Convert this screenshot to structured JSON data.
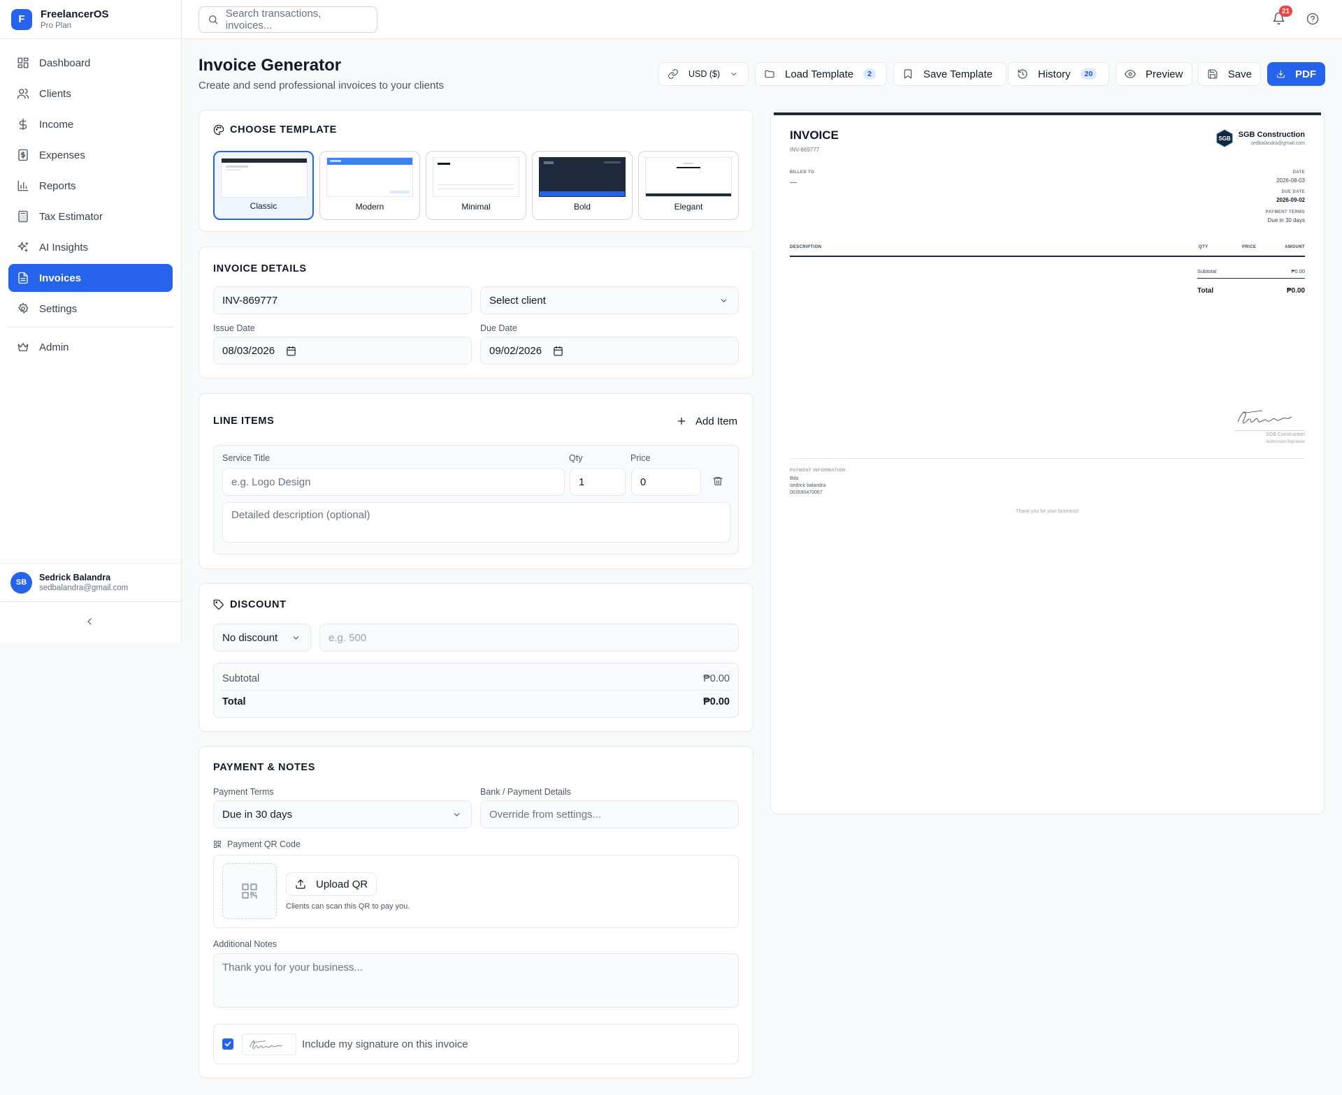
{
  "brand": {
    "logo_letter": "F",
    "name": "FreelancerOS",
    "plan": "Pro Plan"
  },
  "nav": {
    "dashboard": "Dashboard",
    "clients": "Clients",
    "income": "Income",
    "expenses": "Expenses",
    "reports": "Reports",
    "tax": "Tax Estimator",
    "ai": "AI Insights",
    "invoices": "Invoices",
    "settings": "Settings",
    "admin": "Admin",
    "active": "Invoices"
  },
  "user": {
    "initials": "SB",
    "name": "Sedrick Balandra",
    "email": "sedbalandra@gmail.com"
  },
  "topbar": {
    "search_placeholder": "Search transactions, invoices...",
    "notifications": "21"
  },
  "header": {
    "title": "Invoice Generator",
    "subtitle": "Create and send professional invoices to your clients"
  },
  "toolbar": {
    "currency": "USD ($)",
    "load_template": "Load Template",
    "load_count": "2",
    "save_template": "Save Template",
    "history": "History",
    "history_count": "20",
    "preview": "Preview",
    "save": "Save",
    "pdf": "PDF"
  },
  "templates": {
    "title": "CHOOSE TEMPLATE",
    "items": [
      {
        "name": "Classic",
        "selected": true
      },
      {
        "name": "Modern",
        "selected": false
      },
      {
        "name": "Minimal",
        "selected": false
      },
      {
        "name": "Bold",
        "selected": false
      },
      {
        "name": "Elegant",
        "selected": false
      }
    ]
  },
  "details": {
    "title": "INVOICE DETAILS",
    "invoice_number": "INV-869777",
    "client_placeholder": "Select client",
    "issue_label": "Issue Date",
    "issue_value": "08/03/2026",
    "due_label": "Due Date",
    "due_value": "09/02/2026"
  },
  "line_items": {
    "title": "LINE ITEMS",
    "add_label": "Add Item",
    "service_label": "Service Title",
    "service_placeholder": "e.g. Logo Design",
    "qty_label": "Qty",
    "qty_value": "1",
    "price_label": "Price",
    "price_value": "0",
    "description_placeholder": "Detailed description (optional)"
  },
  "discount": {
    "title": "DISCOUNT",
    "type": "No discount",
    "amount_placeholder": "e.g. 500",
    "subtotal_label": "Subtotal",
    "subtotal_value": "₱0.00",
    "total_label": "Total",
    "total_value": "₱0.00"
  },
  "payment": {
    "title": "PAYMENT & NOTES",
    "terms_label": "Payment Terms",
    "terms_value": "Due in 30 days",
    "bank_label": "Bank / Payment Details",
    "bank_placeholder": "Override from settings...",
    "qr_label": "Payment QR Code",
    "upload_label": "Upload QR",
    "qr_hint": "Clients can scan this QR to pay you.",
    "notes_label": "Additional Notes",
    "notes_placeholder": "Thank you for your business...",
    "signature_label": "Include my signature on this invoice",
    "signature_checked": true
  },
  "preview": {
    "heading": "INVOICE",
    "number": "INV-869777",
    "company_logo": "SGB",
    "company_name": "SGB Construction",
    "company_email": "sedbalandra@gmail.com",
    "billed_to_label": "BILLED TO",
    "billed_to_value": "—",
    "date_label": "DATE",
    "date_value": "2026-08-03",
    "due_label": "DUE DATE",
    "due_value": "2026-09-02",
    "terms_label": "PAYMENT TERMS",
    "terms_value": "Due in 30 days",
    "col_description": "DESCRIPTION",
    "col_qty": "QTY",
    "col_price": "PRICE",
    "col_amount": "AMOUNT",
    "subtotal_label": "Subtotal",
    "subtotal_value": "₱0.00",
    "total_label": "Total",
    "total_value": "₱0.00",
    "signer_company": "SGB Construction",
    "signer_caption": "Authorized Signature",
    "payinfo_label": "PAYMENT INFORMATION",
    "bank": "Bdo",
    "account_name": "sedrick balandra",
    "account_number": "003590470067",
    "thanks": "Thank you for your business!"
  },
  "colors": {
    "accent": "#2563eb",
    "danger": "#ef4444",
    "text": "#111827",
    "muted": "#6b7280"
  },
  "icons": [
    "grid-icon",
    "users-icon",
    "dollar-icon",
    "receipt-icon",
    "bar-chart-icon",
    "calculator-icon",
    "sparkles-icon",
    "file-icon",
    "gear-icon",
    "crown-icon",
    "search-icon",
    "bell-icon",
    "help-icon",
    "link-icon",
    "folder-icon",
    "bookmark-icon",
    "history-icon",
    "eye-icon",
    "save-icon",
    "download-icon",
    "palette-icon",
    "plus-icon",
    "trash-icon",
    "tag-icon",
    "qr-icon",
    "upload-icon",
    "chevron-down-icon",
    "chevron-left-icon",
    "calendar-icon"
  ]
}
